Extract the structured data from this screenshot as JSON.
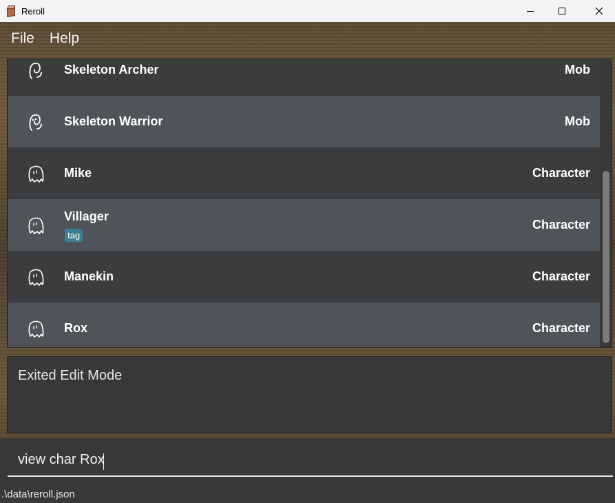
{
  "window": {
    "title": "Reroll"
  },
  "menu": {
    "file": "File",
    "help": "Help"
  },
  "list": {
    "items": [
      {
        "name": "Skeleton Archer",
        "type": "Mob",
        "icon": "skeleton-icon",
        "tags": []
      },
      {
        "name": "Skeleton Warrior",
        "type": "Mob",
        "icon": "skeleton-icon",
        "tags": []
      },
      {
        "name": "Mike",
        "type": "Character",
        "icon": "ghost-icon",
        "tags": []
      },
      {
        "name": "Villager",
        "type": "Character",
        "icon": "ghost-icon",
        "tags": [
          "tag"
        ]
      },
      {
        "name": "Manekin",
        "type": "Character",
        "icon": "ghost-icon",
        "tags": []
      },
      {
        "name": "Rox",
        "type": "Character",
        "icon": "ghost-icon",
        "tags": []
      }
    ]
  },
  "result": {
    "message": "Exited Edit Mode"
  },
  "command": {
    "value": "view char Rox"
  },
  "status": {
    "file_path": ".\\data\\reroll.json"
  },
  "colors": {
    "row_dark": "#3b3c3d",
    "row_light": "#4e5457",
    "tag": "#3c7f92",
    "panel": "#383838"
  }
}
